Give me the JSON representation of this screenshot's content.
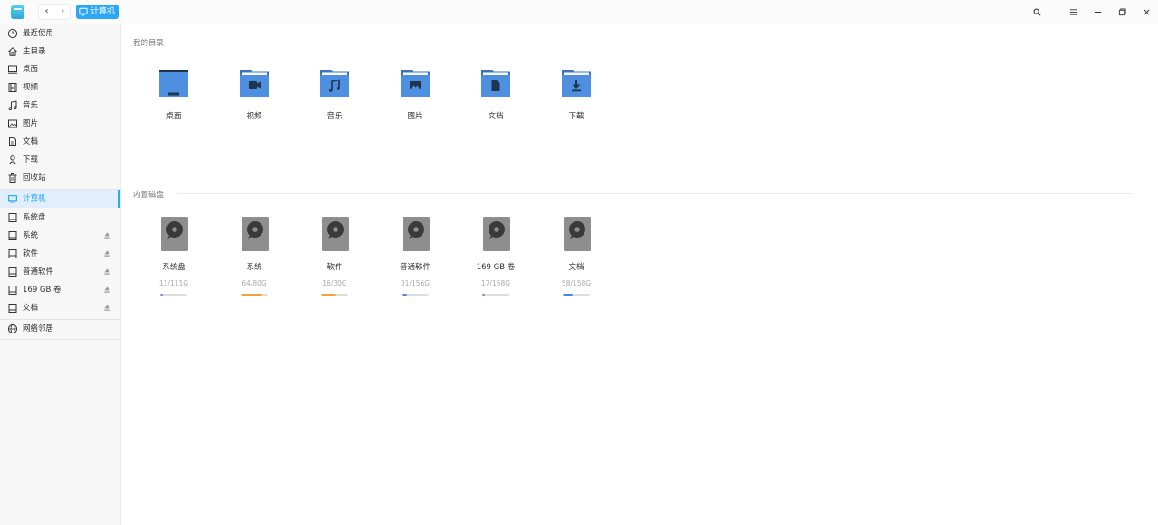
{
  "titlebar": {
    "breadcrumb_label": "计算机",
    "accent": "#2ca7f8"
  },
  "sidebar": {
    "items": [
      {
        "label": "最近使用",
        "icon": "clock-icon"
      },
      {
        "label": "主目录",
        "icon": "home-icon"
      },
      {
        "label": "桌面",
        "icon": "desktop-icon"
      },
      {
        "label": "视频",
        "icon": "film-icon"
      },
      {
        "label": "音乐",
        "icon": "music-icon"
      },
      {
        "label": "图片",
        "icon": "picture-icon"
      },
      {
        "label": "文档",
        "icon": "document-icon"
      },
      {
        "label": "下载",
        "icon": "download-icon"
      },
      {
        "label": "回收站",
        "icon": "trash-icon"
      },
      {
        "label": "计算机",
        "icon": "computer-icon",
        "active": true
      },
      {
        "label": "系统盘",
        "icon": "drive-icon"
      },
      {
        "label": "系统",
        "icon": "drive-icon",
        "eject": true
      },
      {
        "label": "软件",
        "icon": "drive-icon",
        "eject": true
      },
      {
        "label": "普通软件",
        "icon": "drive-icon",
        "eject": true
      },
      {
        "label": "169 GB 卷",
        "icon": "drive-icon",
        "eject": true
      },
      {
        "label": "文档",
        "icon": "drive-icon",
        "eject": true
      },
      {
        "label": "网络邻居",
        "icon": "network-icon"
      }
    ]
  },
  "main": {
    "my_dirs_title": "我的目录",
    "folders": [
      {
        "label": "桌面",
        "icon": "desktop-folder-icon"
      },
      {
        "label": "视频",
        "icon": "video-folder-icon"
      },
      {
        "label": "音乐",
        "icon": "music-folder-icon"
      },
      {
        "label": "图片",
        "icon": "picture-folder-icon"
      },
      {
        "label": "文档",
        "icon": "document-folder-icon"
      },
      {
        "label": "下载",
        "icon": "download-folder-icon"
      }
    ],
    "disks_title": "内置磁盘",
    "disks": [
      {
        "label": "系统盘",
        "usage": "11/111G",
        "fraction": 0.1,
        "color": "#3d8be8"
      },
      {
        "label": "系统",
        "usage": "64/80G",
        "fraction": 0.8,
        "color": "#f0a438"
      },
      {
        "label": "软件",
        "usage": "16/30G",
        "fraction": 0.53,
        "color": "#f0a438"
      },
      {
        "label": "普通软件",
        "usage": "31/156G",
        "fraction": 0.2,
        "color": "#3d8be8"
      },
      {
        "label": "169 GB 卷",
        "usage": "17/158G",
        "fraction": 0.11,
        "color": "#3d8be8"
      },
      {
        "label": "文档",
        "usage": "58/158G",
        "fraction": 0.37,
        "color": "#3d8be8"
      }
    ]
  }
}
